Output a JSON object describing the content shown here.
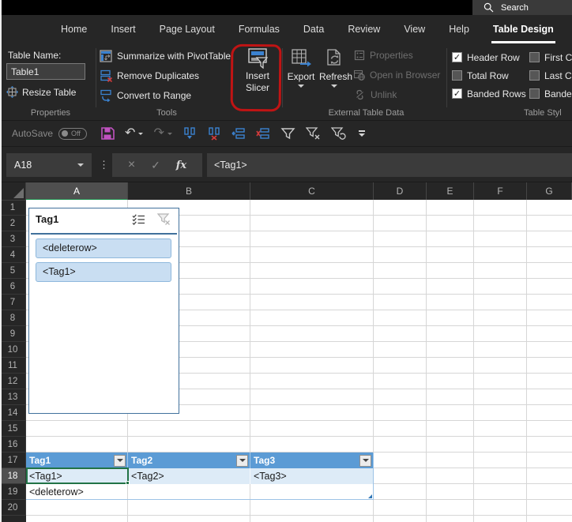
{
  "titlebar": {
    "search_label": "Search"
  },
  "tabs": [
    {
      "label": "Home"
    },
    {
      "label": "Insert"
    },
    {
      "label": "Page Layout"
    },
    {
      "label": "Formulas"
    },
    {
      "label": "Data"
    },
    {
      "label": "Review"
    },
    {
      "label": "View"
    },
    {
      "label": "Help"
    },
    {
      "label": "Table Design",
      "active": true
    }
  ],
  "ribbon": {
    "properties_group": {
      "table_name_label": "Table Name:",
      "table_name_value": "Table1",
      "resize_table_label": "Resize Table",
      "group_label": "Properties"
    },
    "tools_group": {
      "items": [
        {
          "label": "Summarize with PivotTable",
          "icon": "pivottable-icon"
        },
        {
          "label": "Remove Duplicates",
          "icon": "remove-duplicates-icon"
        },
        {
          "label": "Convert to Range",
          "icon": "convert-to-range-icon"
        }
      ],
      "group_label": "Tools"
    },
    "insert_slicer": {
      "label_line1": "Insert",
      "label_line2": "Slicer"
    },
    "external_group": {
      "export_label": "Export",
      "refresh_label": "Refresh",
      "disabled_items": [
        {
          "label": "Properties",
          "icon": "properties-icon"
        },
        {
          "label": "Open in Browser",
          "icon": "open-in-browser-icon"
        },
        {
          "label": "Unlink",
          "icon": "unlink-icon"
        }
      ],
      "group_label": "External Table Data"
    },
    "style_options_group": {
      "checkboxes": [
        {
          "label": "Header Row",
          "checked": true
        },
        {
          "label": "Total Row",
          "checked": false
        },
        {
          "label": "Banded Rows",
          "checked": true
        },
        {
          "label": "First C",
          "checked": false
        },
        {
          "label": "Last C",
          "checked": false
        },
        {
          "label": "Bande",
          "checked": false
        }
      ],
      "group_label": "Table Styl"
    }
  },
  "qat": {
    "autosave_label": "AutoSave",
    "autosave_state": "Off"
  },
  "formula_bar": {
    "name_box_value": "A18",
    "fx_label": "fx",
    "formula_value": "<Tag1>"
  },
  "grid": {
    "column_headers": [
      "A",
      "B",
      "C",
      "D",
      "E",
      "F",
      "G"
    ],
    "selected_column": "A",
    "row_headers": [
      "1",
      "2",
      "3",
      "4",
      "5",
      "6",
      "7",
      "8",
      "9",
      "10",
      "11",
      "12",
      "13",
      "14",
      "15",
      "16",
      "17",
      "18",
      "19",
      "20"
    ],
    "selected_row": "18"
  },
  "slicer": {
    "title": "Tag1",
    "items": [
      {
        "label": "<deleterow>",
        "selected": true
      },
      {
        "label": "<Tag1>",
        "selected": true
      }
    ]
  },
  "sheet_table": {
    "headers": [
      "Tag1",
      "Tag2",
      "Tag3"
    ],
    "rows": [
      [
        "<Tag1>",
        "<Tag2>",
        "<Tag3>"
      ],
      [
        "<deleterow>",
        "",
        ""
      ]
    ],
    "selected_cell": "A18"
  },
  "colors": {
    "table_header_blue": "#5b9bd5",
    "banded_row_blue": "#ddebf7",
    "selection_green": "#217346",
    "slicer_border_blue": "#41719c",
    "slicer_item_fill": "#c9def2",
    "annotation_red": "#c01414",
    "save_icon_magenta": "#c052c0",
    "accent_blue": "#3b82d0",
    "header_accent_green": "#1e8e4e"
  }
}
